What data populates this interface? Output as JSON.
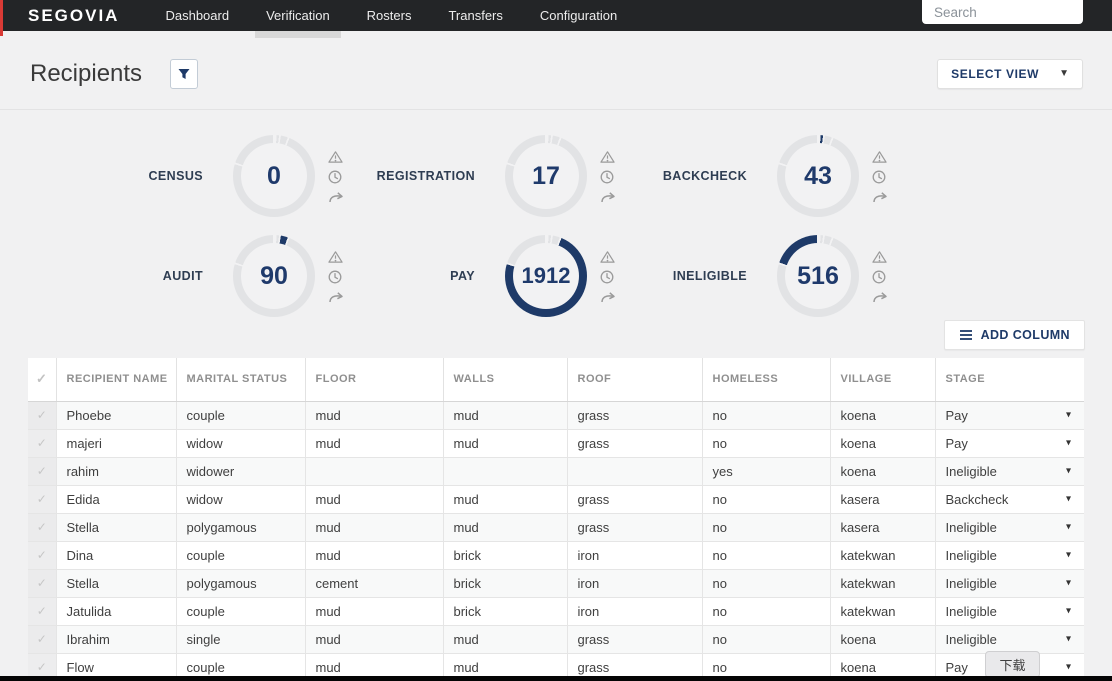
{
  "topbar": {
    "logo": "SEGOVIA",
    "nav_items": [
      {
        "label": "Dashboard",
        "active": false
      },
      {
        "label": "Verification",
        "active": true
      },
      {
        "label": "Rosters",
        "active": false
      },
      {
        "label": "Transfers",
        "active": false
      },
      {
        "label": "Configuration",
        "active": false
      }
    ],
    "search": {
      "placeholder": "Search"
    }
  },
  "header": {
    "title": "Recipients",
    "select_view_label": "SELECT VIEW"
  },
  "stats": {
    "widgets": [
      {
        "label": "CENSUS",
        "value": 0
      },
      {
        "label": "REGISTRATION",
        "value": 17
      },
      {
        "label": "BACKCHECK",
        "value": 43
      },
      {
        "label": "AUDIT",
        "value": 90
      },
      {
        "label": "PAY",
        "value": 1912
      },
      {
        "label": "INELIGIBLE",
        "value": 516
      }
    ],
    "ring_colors": {
      "active": "#1e3a68",
      "inactive": "#e2e3e5",
      "gap": "#f2f2f3"
    }
  },
  "toolbar": {
    "add_column_label": "ADD COLUMN"
  },
  "table": {
    "columns": [
      "RECIPIENT NAME",
      "MARITAL STATUS",
      "FLOOR",
      "WALLS",
      "ROOF",
      "HOMELESS",
      "VILLAGE",
      "STAGE"
    ],
    "rows": [
      {
        "recipient_name": "Phoebe",
        "marital_status": "couple",
        "floor": "mud",
        "walls": "mud",
        "roof": "grass",
        "homeless": "no",
        "village": "koena",
        "stage": "Pay"
      },
      {
        "recipient_name": "majeri",
        "marital_status": "widow",
        "floor": "mud",
        "walls": "mud",
        "roof": "grass",
        "homeless": "no",
        "village": "koena",
        "stage": "Pay"
      },
      {
        "recipient_name": "rahim",
        "marital_status": "widower",
        "floor": "",
        "walls": "",
        "roof": "",
        "homeless": "yes",
        "village": "koena",
        "stage": "Ineligible"
      },
      {
        "recipient_name": "Edida",
        "marital_status": "widow",
        "floor": "mud",
        "walls": "mud",
        "roof": "grass",
        "homeless": "no",
        "village": "kasera",
        "stage": "Backcheck"
      },
      {
        "recipient_name": "Stella",
        "marital_status": "polygamous",
        "floor": "mud",
        "walls": "mud",
        "roof": "grass",
        "homeless": "no",
        "village": "kasera",
        "stage": "Ineligible"
      },
      {
        "recipient_name": "Dina",
        "marital_status": "couple",
        "floor": "mud",
        "walls": "brick",
        "roof": "iron",
        "homeless": "no",
        "village": "katekwan",
        "stage": "Ineligible"
      },
      {
        "recipient_name": "Stella",
        "marital_status": "polygamous",
        "floor": "cement",
        "walls": "brick",
        "roof": "iron",
        "homeless": "no",
        "village": "katekwan",
        "stage": "Ineligible"
      },
      {
        "recipient_name": "Jatulida",
        "marital_status": "couple",
        "floor": "mud",
        "walls": "brick",
        "roof": "iron",
        "homeless": "no",
        "village": "katekwan",
        "stage": "Ineligible"
      },
      {
        "recipient_name": "Ibrahim",
        "marital_status": "single",
        "floor": "mud",
        "walls": "mud",
        "roof": "grass",
        "homeless": "no",
        "village": "koena",
        "stage": "Ineligible"
      },
      {
        "recipient_name": "Flow",
        "marital_status": "couple",
        "floor": "mud",
        "walls": "mud",
        "roof": "grass",
        "homeless": "no",
        "village": "koena",
        "stage": "Pay"
      }
    ]
  },
  "overlay": {
    "download_tooltip": "下载"
  },
  "icons": {
    "check": "✓",
    "caret": "▾",
    "select_caret": "▼"
  },
  "colors": {
    "accent_red": "#d93a35",
    "navy": "#1e3a68",
    "topbar_bg": "#232527"
  }
}
